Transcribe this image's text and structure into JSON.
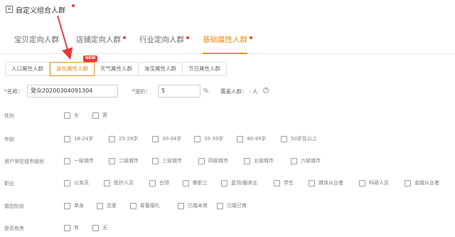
{
  "header": {
    "title": "自定义组合人群"
  },
  "main_tabs": [
    {
      "label": "宝贝定向人群",
      "active": false,
      "dot": false
    },
    {
      "label": "店铺定向人群",
      "active": false,
      "dot": true
    },
    {
      "label": "行业定向人群",
      "active": false,
      "dot": true
    },
    {
      "label": "基础属性人群",
      "active": true,
      "dot": true
    }
  ],
  "sub_tabs": [
    {
      "label": "人口属性人群",
      "active": false
    },
    {
      "label": "身份属性人群",
      "active": true,
      "badge": "NEW"
    },
    {
      "label": "天气属性人群",
      "active": false
    },
    {
      "label": "淘宝属性人群",
      "active": false
    },
    {
      "label": "节日属性人群",
      "active": false
    }
  ],
  "form": {
    "name_label": "名称：",
    "name_value": "受众20200304091304",
    "premium_label": "溢价：",
    "premium_value": "5",
    "percent": "%",
    "coverage_label": "覆盖人群：",
    "coverage_value": "- 人",
    "coverage_icon": "help-circle-icon"
  },
  "attributes": [
    {
      "label": "性别",
      "options": [
        "女",
        "男"
      ]
    },
    {
      "label": "年龄",
      "options": [
        "18-24岁",
        "25-29岁",
        "30-34岁",
        "35-39岁",
        "40-49岁",
        "50岁及以上"
      ]
    },
    {
      "label": "用户常驻城市级别",
      "options": [
        "一级城市",
        "二级城市",
        "三级城市",
        "四级城市",
        "五级城市",
        "六级城市"
      ]
    },
    {
      "label": "职业",
      "options": [
        "公务员",
        "医护人员",
        "白领",
        "教职工",
        "蓝领/服务业",
        "学生",
        "媒体从业者",
        "科研人员",
        "金融从业者"
      ]
    },
    {
      "label": "婚恋阶段",
      "options": [
        "单身",
        "恋爱",
        "筹备婚礼",
        "已婚未育",
        "已婚已育"
      ]
    },
    {
      "label": "是否有房",
      "options": [
        "有",
        "无"
      ]
    }
  ],
  "colors": {
    "accent": "#e88b16",
    "alert": "#e4393c"
  }
}
